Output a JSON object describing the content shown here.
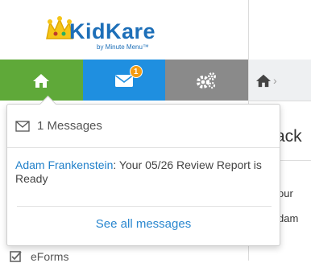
{
  "logo": {
    "brand": "KidKare",
    "tagline": "by Minute Menu™"
  },
  "nav": {
    "home_icon": "home-icon",
    "messages_icon": "envelope-icon",
    "settings_icon": "gears-icon",
    "badge_count": "1",
    "colors": {
      "home": "#5fa939",
      "messages": "#1f8fe0",
      "settings": "#8a8a8a",
      "badge": "#f39c12"
    }
  },
  "messages_dropdown": {
    "header_icon": "envelope-outline-icon",
    "header": "1 Messages",
    "items": [
      {
        "sender": "Adam Frankenstein",
        "text": ": Your 05/26 Review Report is Ready"
      }
    ],
    "see_all": "See all messages"
  },
  "sidebar": {
    "partial_item": {
      "icon": "checkbox-icon",
      "label": "eForms"
    }
  },
  "main": {
    "breadcrumb_icon": "home-icon",
    "breadcrumb_sep": "›",
    "heading_fragment": "ack",
    "line1_fragment": "our",
    "line2_fragment": "dam"
  }
}
